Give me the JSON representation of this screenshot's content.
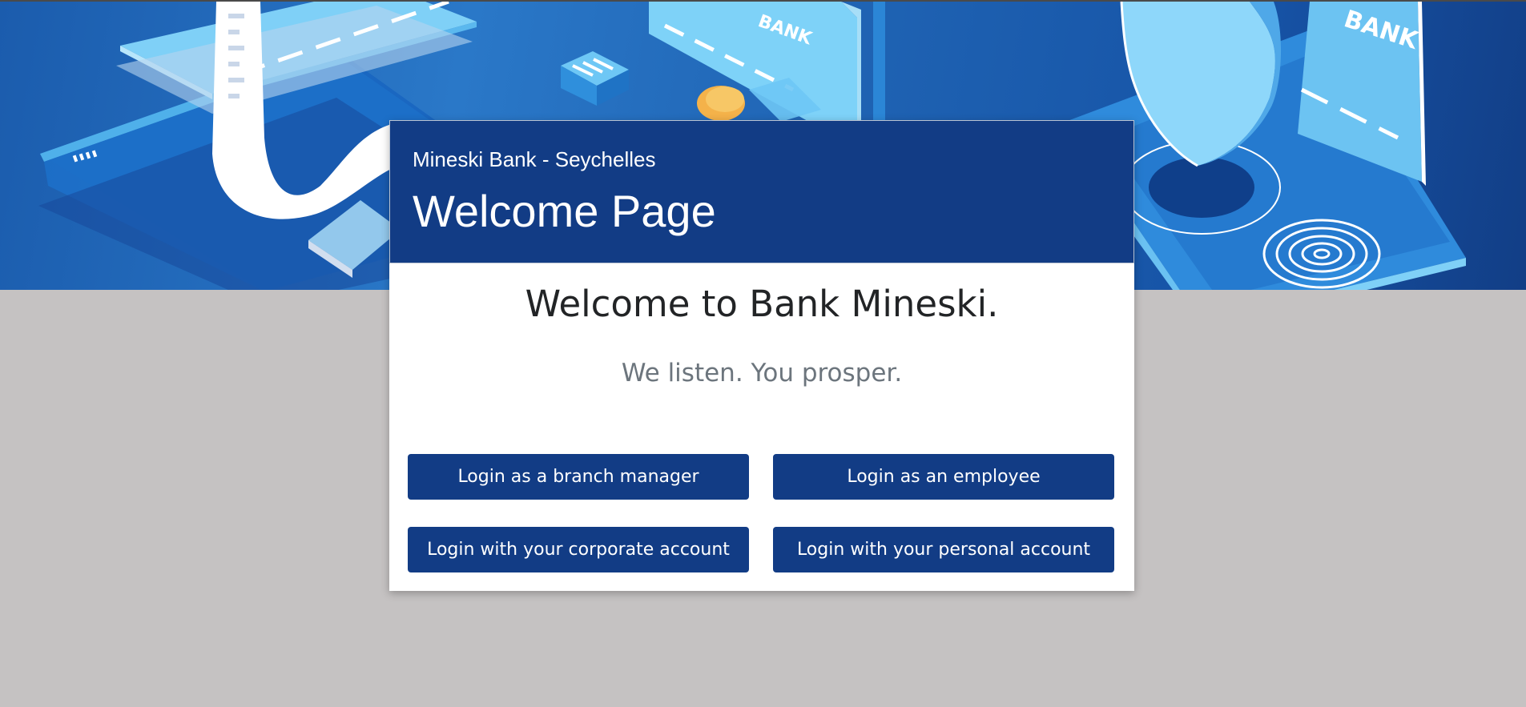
{
  "hero": {
    "illustration": "isometric-banking-illustration",
    "bank_labels": [
      "BANK",
      "BANK"
    ],
    "colors": {
      "background": "#1b5cad",
      "light_blue": "#6cc3f2",
      "white": "#ffffff"
    }
  },
  "header": {
    "subtitle": "Mineski Bank - Seychelles",
    "title": "Welcome Page"
  },
  "main": {
    "welcome": "Welcome to Bank Mineski.",
    "tagline": "We listen. You prosper."
  },
  "buttons": {
    "branch_manager": "Login as a branch manager",
    "employee": "Login as an employee",
    "corporate": "Login with your corporate account",
    "personal": "Login with your personal account"
  },
  "colors": {
    "primary": "#123c85",
    "page_background": "#c5c2c2",
    "card_background": "#ffffff",
    "tagline": "#6c757d"
  }
}
